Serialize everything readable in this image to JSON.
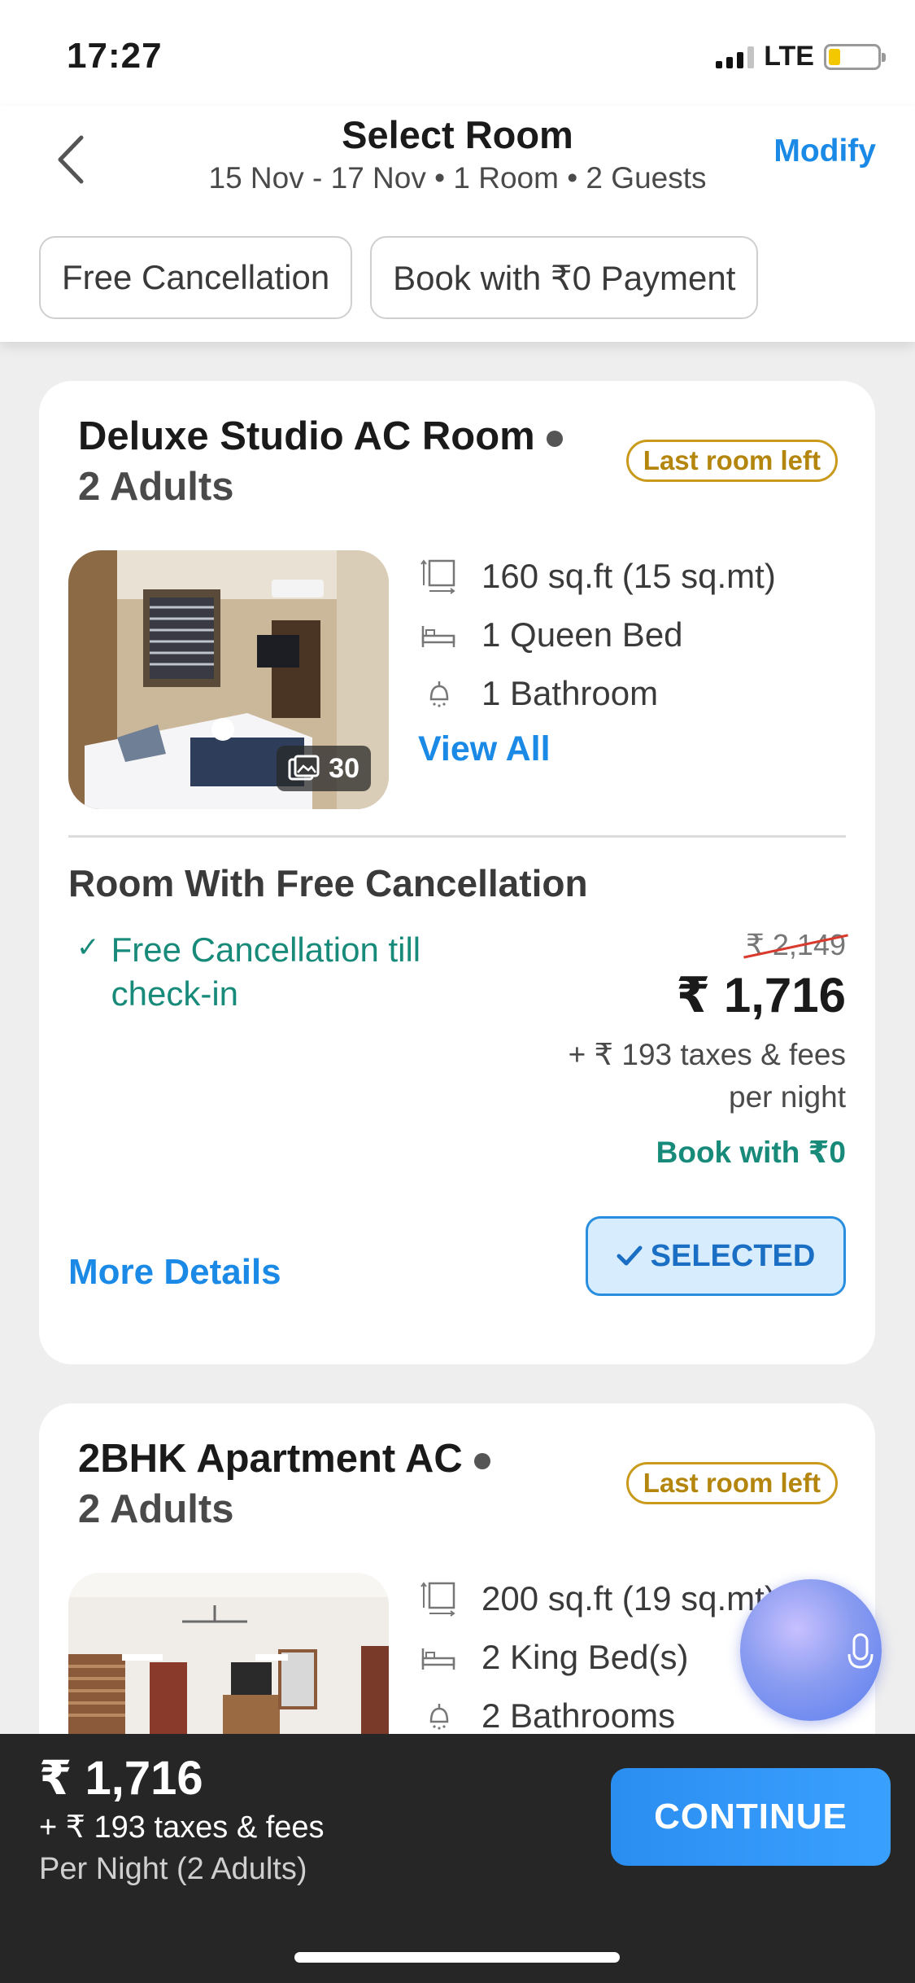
{
  "status_bar": {
    "time": "17:27",
    "network": "LTE"
  },
  "header": {
    "title": "Select Room",
    "subtitle": "15 Nov - 17 Nov • 1 Room • 2 Guests",
    "modify_label": "Modify"
  },
  "filters": [
    "Free Cancellation",
    "Book with ₹0 Payment"
  ],
  "rooms": [
    {
      "name": "Deluxe Studio AC Room",
      "adults": "2 Adults",
      "badge": "Last room left",
      "photo_count": "30",
      "amenities": [
        {
          "icon": "area-icon",
          "label": "160 sq.ft (15 sq.mt)"
        },
        {
          "icon": "bed-icon",
          "label": "1 Queen Bed"
        },
        {
          "icon": "shower-icon",
          "label": "1 Bathroom"
        }
      ],
      "view_all_label": "View All",
      "plan": {
        "title": "Room With Free Cancellation",
        "feature": "Free Cancellation till check-in",
        "original_price": "₹ 2,149",
        "price": "₹ 1,716",
        "taxes": "+ ₹ 193 taxes & fees",
        "per_night": "per night",
        "zero_payment": "Book with ₹0",
        "more_details_label": "More Details",
        "selected_label": "SELECTED"
      }
    },
    {
      "name": "2BHK Apartment AC",
      "adults": "2 Adults",
      "badge": "Last room left",
      "amenities": [
        {
          "icon": "area-icon",
          "label": "200 sq.ft (19 sq.mt)"
        },
        {
          "icon": "bed-icon",
          "label": "2 King Bed(s)"
        },
        {
          "icon": "shower-icon",
          "label": "2 Bathrooms"
        }
      ]
    }
  ],
  "bottom_bar": {
    "price": "₹ 1,716",
    "taxes": "+ ₹ 193 taxes & fees",
    "per_night": "Per Night (2 Adults)",
    "continue_label": "CONTINUE"
  },
  "colors": {
    "accent": "#1a8ae6",
    "success": "#178a7a",
    "badge": "#c99a1b",
    "bottom_bar": "#262626"
  }
}
